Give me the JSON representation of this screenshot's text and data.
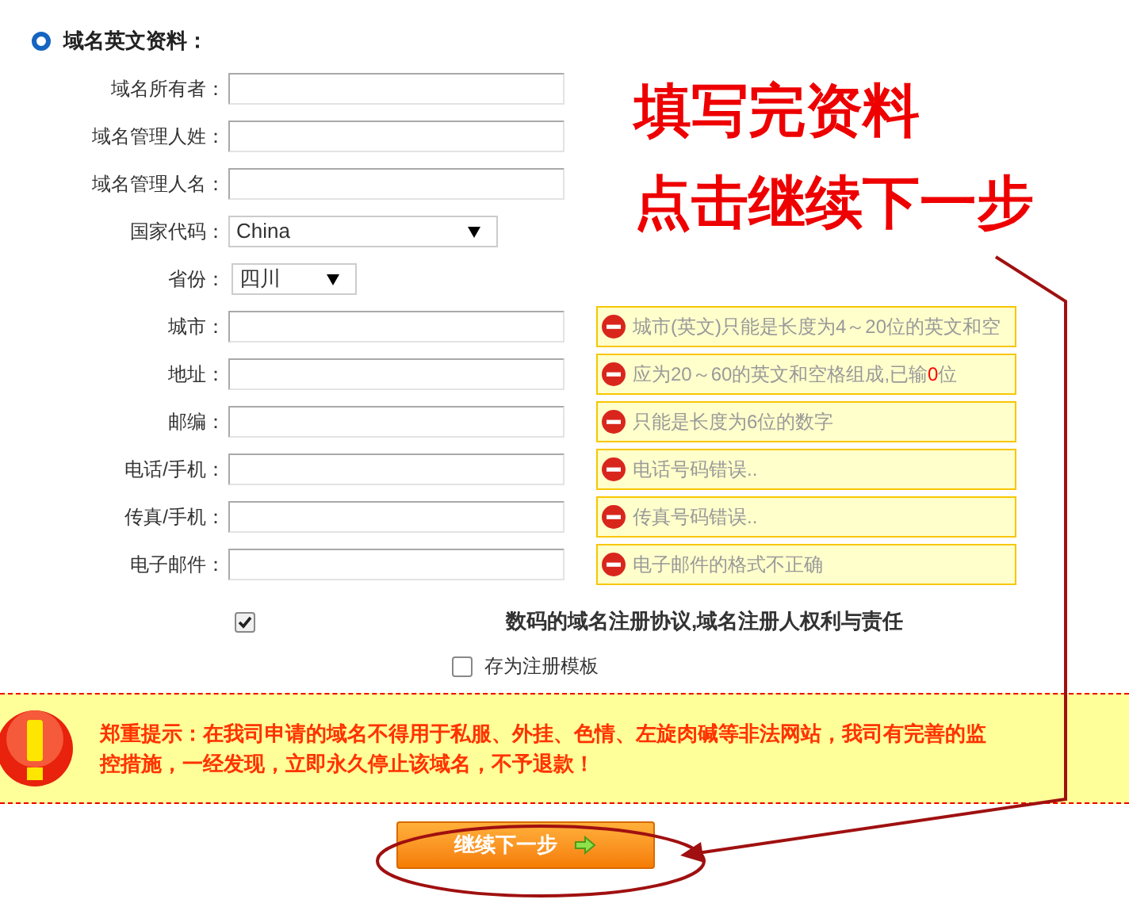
{
  "section": {
    "title": "域名英文资料："
  },
  "fields": [
    {
      "label": "域名所有者：",
      "kind": "text"
    },
    {
      "label": "域名管理人姓：",
      "kind": "text"
    },
    {
      "label": "域名管理人名：",
      "kind": "text"
    },
    {
      "label": "国家代码：",
      "kind": "wide_select",
      "value": "China"
    },
    {
      "label": "省份：",
      "kind": "narrow_select",
      "value": "四川"
    },
    {
      "label": "城市：",
      "kind": "text",
      "error": [
        {
          "text": "城市(英文)只能是长度为4～20位的英文和空",
          "highlight": false
        }
      ]
    },
    {
      "label": "地址：",
      "kind": "text",
      "error": [
        {
          "text": "应为20～60的英文和空格组成,已输",
          "highlight": false
        },
        {
          "text": "0",
          "highlight": true
        },
        {
          "text": "位",
          "highlight": false
        }
      ]
    },
    {
      "label": "邮编：",
      "kind": "text",
      "error": [
        {
          "text": "只能是长度为6位的数字",
          "highlight": false
        }
      ]
    },
    {
      "label": "电话/手机：",
      "kind": "text",
      "error": [
        {
          "text": "电话号码错误..",
          "highlight": false
        }
      ]
    },
    {
      "label": "传真/手机：",
      "kind": "text",
      "error": [
        {
          "text": "传真号码错误..",
          "highlight": false
        }
      ]
    },
    {
      "label": "电子邮件：",
      "kind": "text",
      "error": [
        {
          "text": "电子邮件的格式不正确",
          "highlight": false
        }
      ]
    }
  ],
  "agreement": {
    "checked": true,
    "text": "数码的域名注册协议,域名注册人权利与责任"
  },
  "save_template": {
    "checked": false,
    "label": "存为注册模板"
  },
  "warning": {
    "text": "郑重提示：在我司申请的域名不得用于私服、外挂、色情、左旋肉碱等非法网站，我司有完善的监控措施，一经发现，立即永久停止该域名，不予退款！"
  },
  "continue_button": {
    "label": "继续下一步"
  },
  "annotation": {
    "lines": [
      "填写完资料",
      "点击继续下一步"
    ]
  }
}
